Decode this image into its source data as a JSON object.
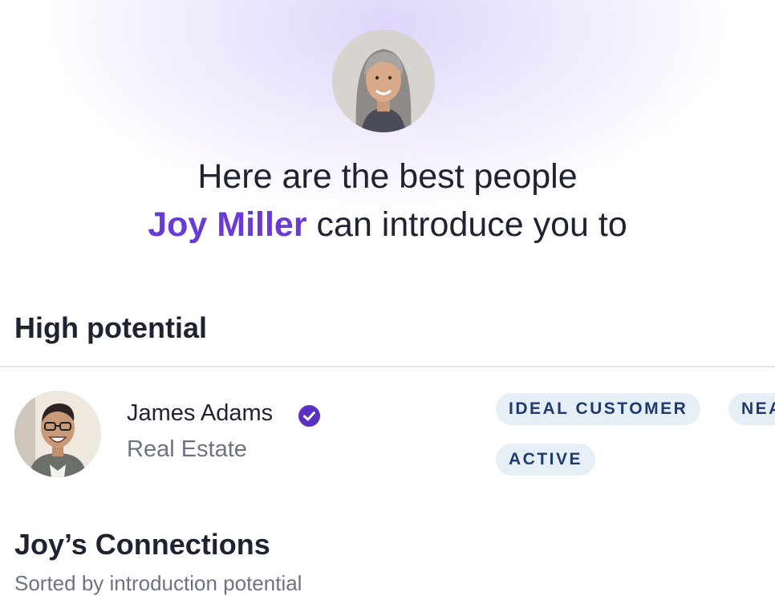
{
  "hero": {
    "headline_line1": "Here are the best people",
    "headline_name": "Joy Miller",
    "headline_rest": " can introduce you to"
  },
  "sections": {
    "high_potential_title": "High potential",
    "connections_title": "Joy’s Connections",
    "connections_subtitle": "Sorted by introduction potential"
  },
  "person": {
    "name": "James Adams",
    "role": "Real Estate",
    "verified_icon": "verified-check-icon",
    "tags": [
      "IDEAL CUSTOMER",
      "NEA",
      "ACTIVE"
    ]
  },
  "colors": {
    "accent": "#6a3ad8",
    "tag_bg": "#e6eef6",
    "tag_text": "#1e3a6e",
    "text_primary": "#1f2230",
    "text_secondary": "#6e7381"
  }
}
